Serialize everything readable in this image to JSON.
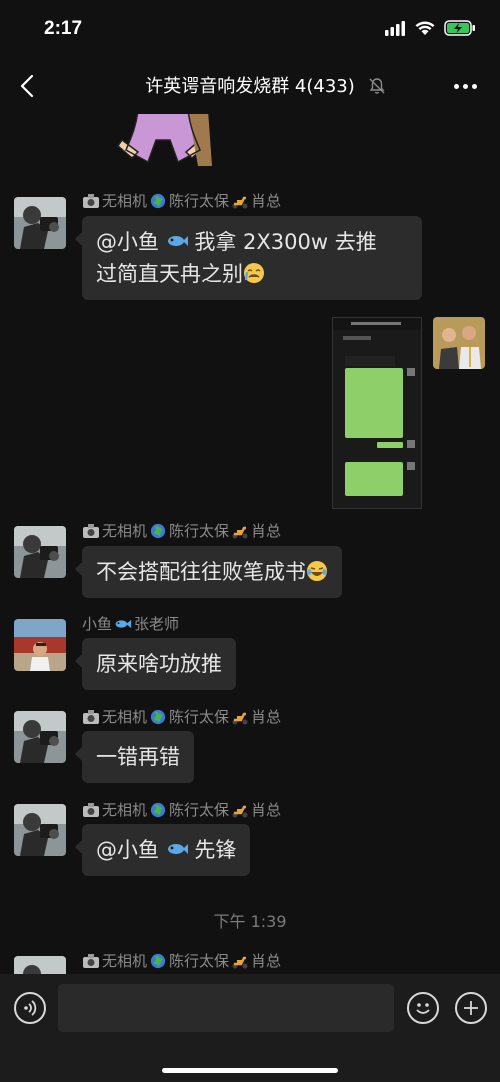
{
  "status_bar": {
    "time": "2:17"
  },
  "header": {
    "title": "许英谔音响发烧群 4(433)"
  },
  "messages": [
    {
      "sender_prefix": "无相机",
      "sender_mid": "陈行太保",
      "sender_suffix": "肖总",
      "text_line1": "@小鱼",
      "text_line1_after": "我拿 2X300w 去推",
      "text_line2": "过简直天冉之别"
    },
    {
      "type": "image",
      "caption": ""
    },
    {
      "sender_prefix": "无相机",
      "sender_mid": "陈行太保",
      "sender_suffix": "肖总",
      "text": "不会搭配往往败笔成书"
    },
    {
      "sender_prefix": "小鱼",
      "sender_suffix": "张老师",
      "text": "原来啥功放推"
    },
    {
      "sender_prefix": "无相机",
      "sender_mid": "陈行太保",
      "sender_suffix": "肖总",
      "text": "一错再错"
    },
    {
      "sender_prefix": "无相机",
      "sender_mid": "陈行太保",
      "sender_suffix": "肖总",
      "text_before": "@小鱼",
      "text_after": "先锋"
    },
    {
      "sender_prefix": "无相机",
      "sender_mid": "陈行太保",
      "sender_suffix": "肖总"
    }
  ],
  "time_separator": "下午 1:39",
  "input": {
    "placeholder": ""
  },
  "colors": {
    "background": "#111111",
    "bubble": "#2c2c2c",
    "sender_text": "#8a8a8a"
  }
}
